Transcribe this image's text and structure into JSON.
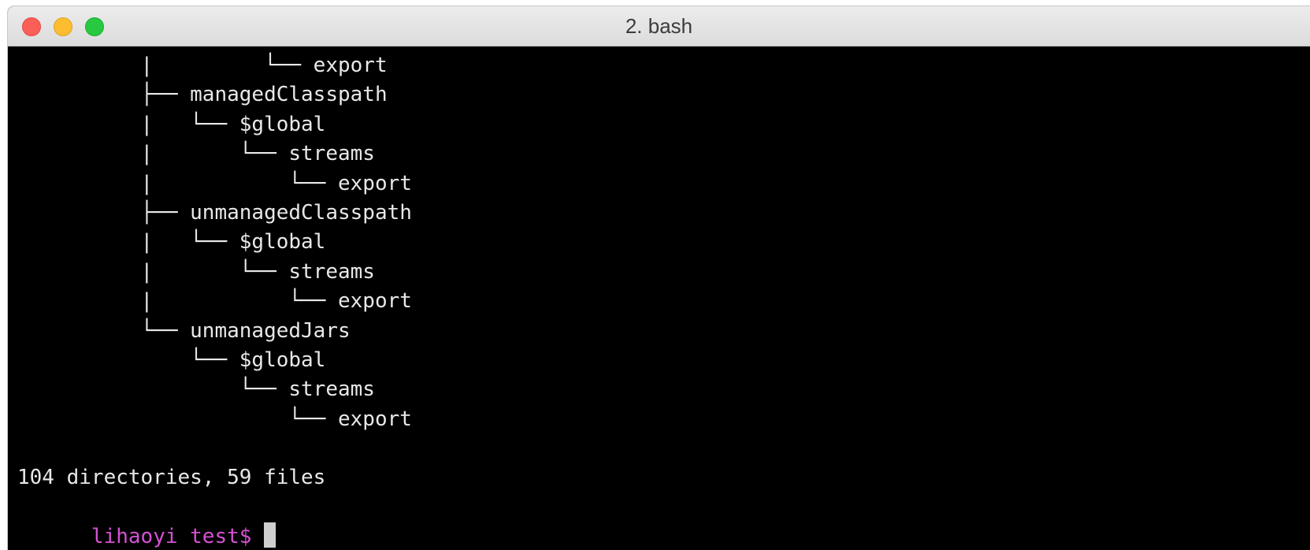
{
  "window": {
    "title": "2. bash"
  },
  "terminal": {
    "lines": [
      "          |         └── export",
      "          ├── managedClasspath",
      "          |   └── $global",
      "          |       └── streams",
      "          |           └── export",
      "          ├── unmanagedClasspath",
      "          |   └── $global",
      "          |       └── streams",
      "          |           └── export",
      "          └── unmanagedJars",
      "              └── $global",
      "                  └── streams",
      "                      └── export",
      "",
      "104 directories, 59 files"
    ],
    "prompt": "lihaoyi test$ "
  },
  "colors": {
    "background": "#000000",
    "text": "#e8e8e8",
    "prompt": "#d451d4",
    "close": "#fc5f57",
    "minimize": "#fdbd2e",
    "maximize": "#28c940"
  }
}
